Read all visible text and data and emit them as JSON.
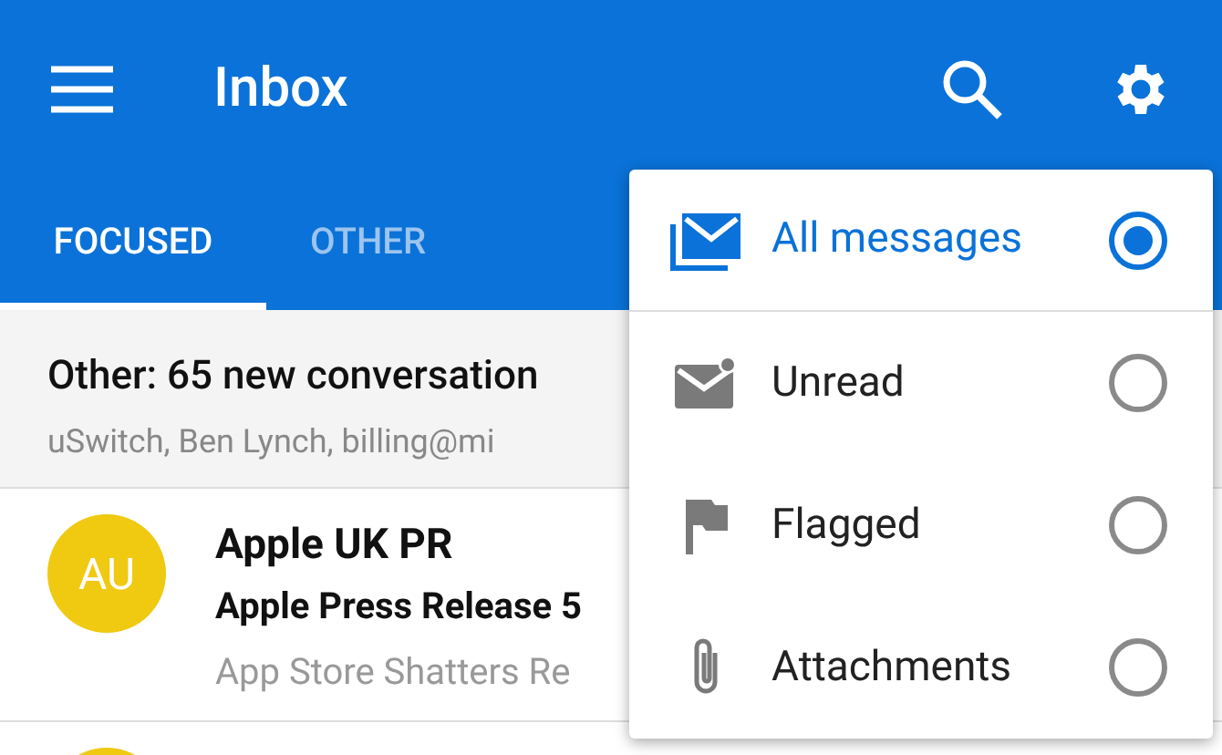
{
  "app_bar": {
    "title": "Inbox"
  },
  "tabs": [
    {
      "label": "FOCUSED",
      "selected": true
    },
    {
      "label": "OTHER",
      "selected": false
    }
  ],
  "other_banner": {
    "title": "Other: 65 new conversation",
    "senders": "uSwitch, Ben Lynch, billing@mi"
  },
  "messages": [
    {
      "initials": "AU",
      "color": "#f0c911",
      "sender": "Apple UK PR",
      "subject": "Apple Press Release 5",
      "preview": "App Store Shatters Re"
    },
    {
      "color": "#f0c911"
    }
  ],
  "filter_menu": [
    {
      "kind": "all",
      "label": "All messages",
      "selected": true
    },
    {
      "kind": "unread",
      "label": "Unread",
      "selected": false
    },
    {
      "kind": "flagged",
      "label": "Flagged",
      "selected": false
    },
    {
      "kind": "attachments",
      "label": "Attachments",
      "selected": false
    }
  ]
}
